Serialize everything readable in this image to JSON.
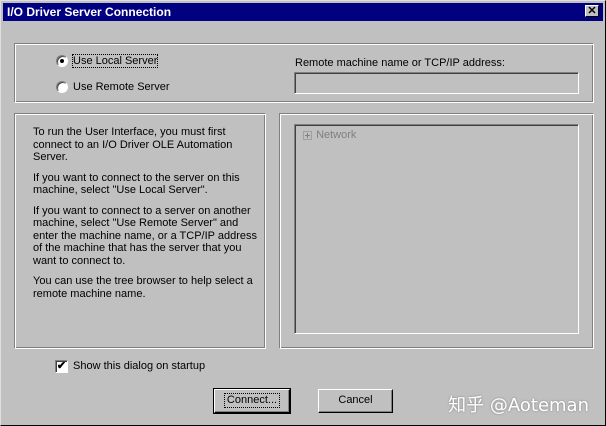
{
  "window": {
    "title": "I/O Driver Server Connection",
    "close_glyph": "✕"
  },
  "server": {
    "local_label": "Use Local Server",
    "remote_label": "Use Remote Server",
    "selected": "local",
    "remote_address_label": "Remote machine name or TCP/IP address:",
    "remote_address_value": ""
  },
  "info": {
    "paragraphs": [
      "To run the User Interface, you must first connect to an  I/O Driver OLE Automation Server.",
      "If you want to connect to the server on this machine, select \"Use Local Server\".",
      "If you want to connect to a server on another machine, select \"Use Remote Server\" and enter the machine name, or a TCP/IP address of the machine that has the server that you want to connect to.",
      "You can use the tree browser to help select a remote machine name."
    ]
  },
  "tree": {
    "root_label": "Network",
    "expander_icon": "plus-box-icon"
  },
  "startup": {
    "label": "Show this dialog on startup",
    "checked": true,
    "check_glyph": "✔"
  },
  "buttons": {
    "connect": "Connect...",
    "cancel": "Cancel"
  },
  "watermark": {
    "text": "知乎 @Aoteman"
  },
  "colors": {
    "titlebar": "#000080",
    "face": "#c0c0c0"
  }
}
